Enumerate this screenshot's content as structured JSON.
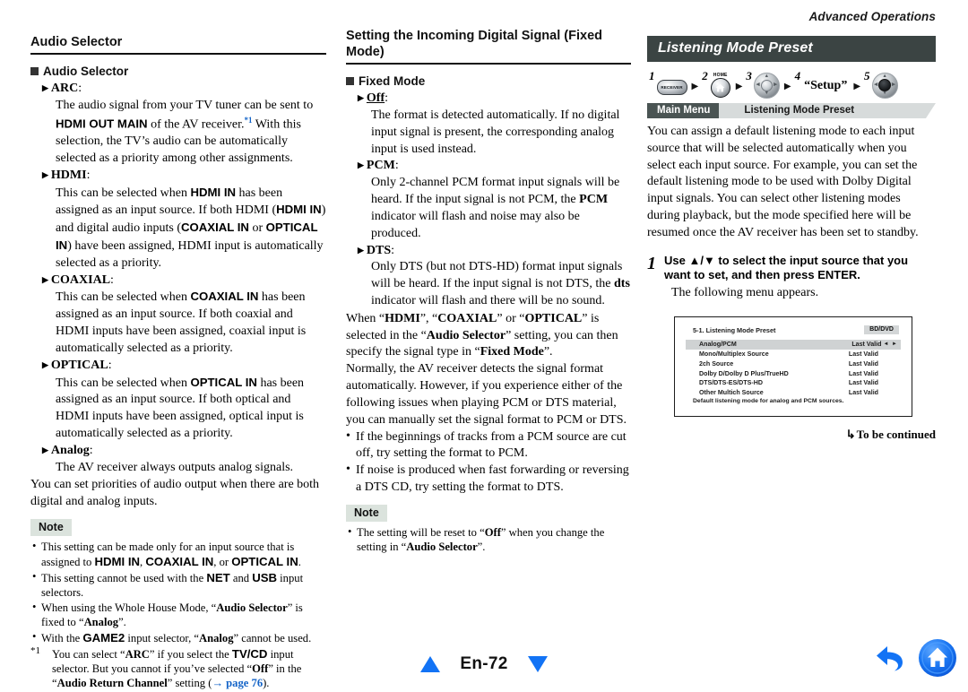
{
  "running_head": "Advanced Operations",
  "footer": {
    "page_label": "En-72",
    "prev_icon": "triangle-up-icon",
    "next_icon": "triangle-down-icon",
    "back_icon": "back-arrow-icon",
    "home_icon": "home-icon"
  },
  "left_column": {
    "section_heading": "Audio Selector",
    "subsection_heading": "Audio Selector",
    "terms": [
      {
        "name": "ARC",
        "body_parts": [
          {
            "t": "The audio signal from your TV tuner can be sent to ",
            "style": "normal"
          },
          {
            "t": "HDMI OUT MAIN",
            "style": "sans-bold"
          },
          {
            "t": " of the AV receiver.",
            "style": "normal"
          },
          {
            "t": "*1",
            "style": "footnote-link"
          },
          {
            "t": " With this selection, the TV’s audio can be automatically selected as a priority among other assignments.",
            "style": "normal"
          }
        ]
      },
      {
        "name": "HDMI",
        "body_parts": [
          {
            "t": "This can be selected when ",
            "style": "normal"
          },
          {
            "t": "HDMI IN",
            "style": "sans-bold"
          },
          {
            "t": " has been assigned as an input source. If both HDMI (",
            "style": "normal"
          },
          {
            "t": "HDMI IN",
            "style": "sans-bold"
          },
          {
            "t": ") and digital audio inputs (",
            "style": "normal"
          },
          {
            "t": "COAXIAL IN",
            "style": "sans-bold"
          },
          {
            "t": " or ",
            "style": "normal"
          },
          {
            "t": "OPTICAL IN",
            "style": "sans-bold"
          },
          {
            "t": ") have been assigned, HDMI input is automatically selected as a priority.",
            "style": "normal"
          }
        ]
      },
      {
        "name": "COAXIAL",
        "body_parts": [
          {
            "t": "This can be selected when ",
            "style": "normal"
          },
          {
            "t": "COAXIAL IN",
            "style": "sans-bold"
          },
          {
            "t": " has been assigned as an input source. If both coaxial and HDMI inputs have been assigned, coaxial input is automatically selected as a priority.",
            "style": "normal"
          }
        ]
      },
      {
        "name": "OPTICAL",
        "body_parts": [
          {
            "t": "This can be selected when ",
            "style": "normal"
          },
          {
            "t": "OPTICAL IN",
            "style": "sans-bold"
          },
          {
            "t": " has been assigned as an input source. If both optical and HDMI inputs have been assigned, optical input is automatically selected as a priority.",
            "style": "normal"
          }
        ]
      },
      {
        "name": "Analog",
        "body_parts": [
          {
            "t": "The AV receiver always outputs analog signals.",
            "style": "normal"
          }
        ]
      }
    ],
    "closing_paragraph": "You can set priorities of audio output when there are both digital and analog inputs.",
    "note_label": "Note",
    "notes": [
      [
        {
          "t": "This setting can be made only for an input source that is assigned to ",
          "style": "normal"
        },
        {
          "t": "HDMI IN",
          "style": "sans-bold"
        },
        {
          "t": ", ",
          "style": "normal"
        },
        {
          "t": "COAXIAL IN",
          "style": "sans-bold"
        },
        {
          "t": ", or ",
          "style": "normal"
        },
        {
          "t": "OPTICAL IN",
          "style": "sans-bold"
        },
        {
          "t": ".",
          "style": "normal"
        }
      ],
      [
        {
          "t": "This setting cannot be used with the ",
          "style": "normal"
        },
        {
          "t": "NET",
          "style": "sans-bold"
        },
        {
          "t": " and ",
          "style": "normal"
        },
        {
          "t": "USB",
          "style": "sans-bold"
        },
        {
          "t": " input selectors.",
          "style": "normal"
        }
      ],
      [
        {
          "t": "When using the Whole House Mode, “",
          "style": "normal"
        },
        {
          "t": "Audio Selector",
          "style": "bold"
        },
        {
          "t": "” is fixed to “",
          "style": "normal"
        },
        {
          "t": "Analog",
          "style": "bold"
        },
        {
          "t": "”.",
          "style": "normal"
        }
      ],
      [
        {
          "t": "With the ",
          "style": "normal"
        },
        {
          "t": "GAME2",
          "style": "sans-bold"
        },
        {
          "t": " input selector, “",
          "style": "normal"
        },
        {
          "t": "Analog",
          "style": "bold"
        },
        {
          "t": "” cannot be used.",
          "style": "normal"
        }
      ]
    ],
    "footnote": {
      "marker": "*1",
      "parts": [
        {
          "t": "You can select “",
          "style": "normal"
        },
        {
          "t": "ARC",
          "style": "bold"
        },
        {
          "t": "” if you select the ",
          "style": "normal"
        },
        {
          "t": "TV/CD",
          "style": "sans-bold"
        },
        {
          "t": " input selector. But you cannot if you’ve selected “",
          "style": "normal"
        },
        {
          "t": "Off",
          "style": "bold"
        },
        {
          "t": "” in the “",
          "style": "normal"
        },
        {
          "t": "Audio Return Channel",
          "style": "bold"
        },
        {
          "t": "” setting (",
          "style": "normal"
        },
        {
          "t": "→ page 76",
          "style": "link"
        },
        {
          "t": ").",
          "style": "normal"
        }
      ]
    }
  },
  "middle_column": {
    "section_heading": "Setting the Incoming Digital Signal (Fixed Mode)",
    "subsection_heading": "Fixed Mode",
    "terms": [
      {
        "name": "Off",
        "underlined": true,
        "body_parts": [
          {
            "t": "The format is detected automatically. If no digital input signal is present, the corresponding analog input is used instead.",
            "style": "normal"
          }
        ]
      },
      {
        "name": "PCM",
        "underlined": false,
        "body_parts": [
          {
            "t": "Only 2-channel PCM format input signals will be heard. If the input signal is not PCM, the ",
            "style": "normal"
          },
          {
            "t": "PCM",
            "style": "bold"
          },
          {
            "t": " indicator will flash and noise may also be produced.",
            "style": "normal"
          }
        ]
      },
      {
        "name": "DTS",
        "underlined": false,
        "body_parts": [
          {
            "t": "Only DTS (but not DTS-HD) format input signals will be heard. If the input signal is not DTS, the ",
            "style": "normal"
          },
          {
            "t": "dts",
            "style": "bold"
          },
          {
            "t": " indicator will flash and there will be no sound.",
            "style": "normal"
          }
        ]
      }
    ],
    "paragraph1_parts": [
      {
        "t": "When “",
        "style": "normal"
      },
      {
        "t": "HDMI",
        "style": "bold"
      },
      {
        "t": "”, “",
        "style": "normal"
      },
      {
        "t": "COAXIAL",
        "style": "bold"
      },
      {
        "t": "” or “",
        "style": "normal"
      },
      {
        "t": "OPTICAL",
        "style": "bold"
      },
      {
        "t": "” is selected in the “",
        "style": "normal"
      },
      {
        "t": "Audio Selector",
        "style": "bold"
      },
      {
        "t": "” setting, you can then specify the signal type in “",
        "style": "normal"
      },
      {
        "t": "Fixed Mode",
        "style": "bold"
      },
      {
        "t": "”.",
        "style": "normal"
      }
    ],
    "paragraph2": "Normally, the AV receiver detects the signal format automatically. However, if you experience either of the following issues when playing PCM or DTS material, you can manually set the signal format to PCM or DTS.",
    "bullets": [
      "If the beginnings of tracks from a PCM source are cut off, try setting the format to PCM.",
      "If noise is produced when fast forwarding or reversing a DTS CD, try setting the format to DTS."
    ],
    "note_label": "Note",
    "notes": [
      [
        {
          "t": "The setting will be reset to “",
          "style": "normal"
        },
        {
          "t": "Off",
          "style": "bold"
        },
        {
          "t": "” when you change the setting in “",
          "style": "normal"
        },
        {
          "t": "Audio Selector",
          "style": "bold"
        },
        {
          "t": "”.",
          "style": "normal"
        }
      ]
    ]
  },
  "right_column": {
    "title": "Listening Mode Preset",
    "op_steps": [
      {
        "num": "1",
        "icon": "receiver-button-icon",
        "label": "RECEIVER"
      },
      {
        "num": "2",
        "icon": "home-button-icon",
        "label": "HOME"
      },
      {
        "num": "3",
        "icon": "dpad-icon",
        "label": ""
      },
      {
        "num": "4",
        "icon": "text-label",
        "label": "“Setup”"
      },
      {
        "num": "5",
        "icon": "dpad-enter-icon",
        "label": ""
      }
    ],
    "breadcrumb": {
      "main": "Main Menu",
      "sub": "Listening Mode Preset"
    },
    "intro": "You can assign a default listening mode to each input source that will be selected automatically when you select each input source. For example, you can set the default listening mode to be used with Dolby Digital input signals. You can select other listening modes during playback, but the mode specified here will be resumed once the AV receiver has been set to standby.",
    "step": {
      "num": "1",
      "heading": "Use ▲/▼ to select the input source that you want to set, and then press ENTER.",
      "sub": "The following menu appears."
    },
    "osd": {
      "title": "5-1. Listening Mode Preset",
      "source_badge": "BD/DVD",
      "rows": [
        {
          "label": "Analog/PCM",
          "value": "Last Valid",
          "selected": true,
          "arrows": "◄ ►"
        },
        {
          "label": "Mono/Multiplex Source",
          "value": "Last Valid",
          "selected": false,
          "arrows": ""
        },
        {
          "label": "2ch Source",
          "value": "Last Valid",
          "selected": false,
          "arrows": ""
        },
        {
          "label": "Dolby D/Dolby D Plus/TrueHD",
          "value": "Last Valid",
          "selected": false,
          "arrows": ""
        },
        {
          "label": "DTS/DTS-ES/DTS-HD",
          "value": "Last Valid",
          "selected": false,
          "arrows": ""
        },
        {
          "label": "Other Multich Source",
          "value": "Last Valid",
          "selected": false,
          "arrows": ""
        }
      ],
      "footer_text": "Default listening mode for analog and PCM sources."
    },
    "to_be_continued": "To be continued"
  },
  "colors": {
    "title_bar_bg": "#3b4443",
    "crumb_main_bg": "#4a5453",
    "crumb_sub_bg": "#d7dbdb",
    "note_badge_bg": "#dbe3dd",
    "link_blue": "#1464c8",
    "footer_blue": "#1273f5",
    "osd_selected_bg": "#cfd2d3"
  }
}
